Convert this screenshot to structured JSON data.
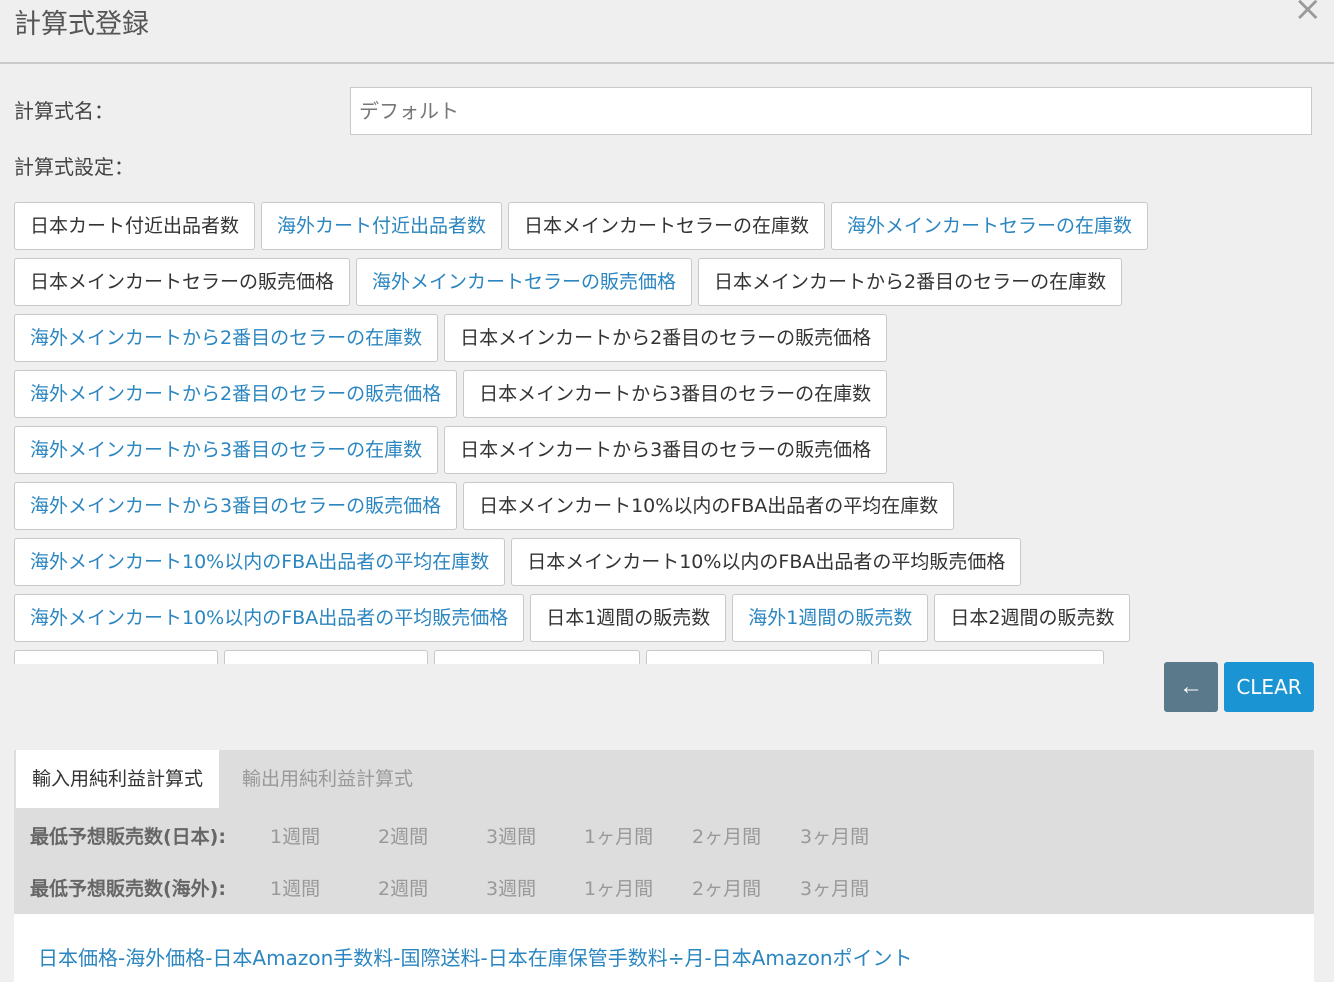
{
  "dialog": {
    "title": "計算式登録",
    "close_glyph": "×"
  },
  "form": {
    "name_label": "計算式名：",
    "name_placeholder": "デフォルト",
    "setting_label": "計算式設定："
  },
  "fields": [
    [
      {
        "label": "日本カート付近出品者数",
        "kind": "jp"
      },
      {
        "label": "海外カート付近出品者数",
        "kind": "ov"
      },
      {
        "label": "日本メインカートセラーの在庫数",
        "kind": "jp"
      },
      {
        "label": "海外メインカートセラーの在庫数",
        "kind": "ov"
      }
    ],
    [
      {
        "label": "日本メインカートセラーの販売価格",
        "kind": "jp"
      },
      {
        "label": "海外メインカートセラーの販売価格",
        "kind": "ov"
      },
      {
        "label": "日本メインカートから2番目のセラーの在庫数",
        "kind": "jp"
      }
    ],
    [
      {
        "label": "海外メインカートから2番目のセラーの在庫数",
        "kind": "ov"
      },
      {
        "label": "日本メインカートから2番目のセラーの販売価格",
        "kind": "jp"
      }
    ],
    [
      {
        "label": "海外メインカートから2番目のセラーの販売価格",
        "kind": "ov"
      },
      {
        "label": "日本メインカートから3番目のセラーの在庫数",
        "kind": "jp"
      }
    ],
    [
      {
        "label": "海外メインカートから3番目のセラーの在庫数",
        "kind": "ov"
      },
      {
        "label": "日本メインカートから3番目のセラーの販売価格",
        "kind": "jp"
      }
    ],
    [
      {
        "label": "海外メインカートから3番目のセラーの販売価格",
        "kind": "ov"
      },
      {
        "label": "日本メインカート10%以内のFBA出品者の平均在庫数",
        "kind": "jp"
      }
    ],
    [
      {
        "label": "海外メインカート10%以内のFBA出品者の平均在庫数",
        "kind": "ov"
      },
      {
        "label": "日本メインカート10%以内のFBA出品者の平均販売価格",
        "kind": "jp"
      }
    ],
    [
      {
        "label": "海外メインカート10%以内のFBA出品者の平均販売価格",
        "kind": "ov"
      },
      {
        "label": "日本1週間の販売数",
        "kind": "jp"
      },
      {
        "label": "海外1週間の販売数",
        "kind": "ov"
      },
      {
        "label": "日本2週間の販売数",
        "kind": "jp"
      }
    ],
    [
      {
        "label": "",
        "kind": "ov"
      },
      {
        "label": "",
        "kind": "jp"
      },
      {
        "label": "",
        "kind": "ov"
      },
      {
        "label": "",
        "kind": "jp"
      },
      {
        "label": "",
        "kind": "ov"
      }
    ]
  ],
  "actions": {
    "back_label": "←",
    "clear_label": "CLEAR"
  },
  "tabs": [
    {
      "label": "輸入用純利益計算式",
      "active": true
    },
    {
      "label": "輸出用純利益計算式",
      "active": false
    }
  ],
  "periods": {
    "jp_label": "最低予想販売数(日本):",
    "ov_label": "最低予想販売数(海外):",
    "options": [
      "1週間",
      "2週間",
      "3週間",
      "1ヶ月間",
      "2ヶ月間",
      "3ヶ月間"
    ]
  },
  "formula": "日本価格-海外価格-日本Amazon手数料-国際送料-日本在庫保管手数料÷月-日本Amazonポイント",
  "colors": {
    "link_blue": "#2b86c0",
    "clear_bg": "#1a94d2",
    "back_bg": "#5a7a8c"
  }
}
